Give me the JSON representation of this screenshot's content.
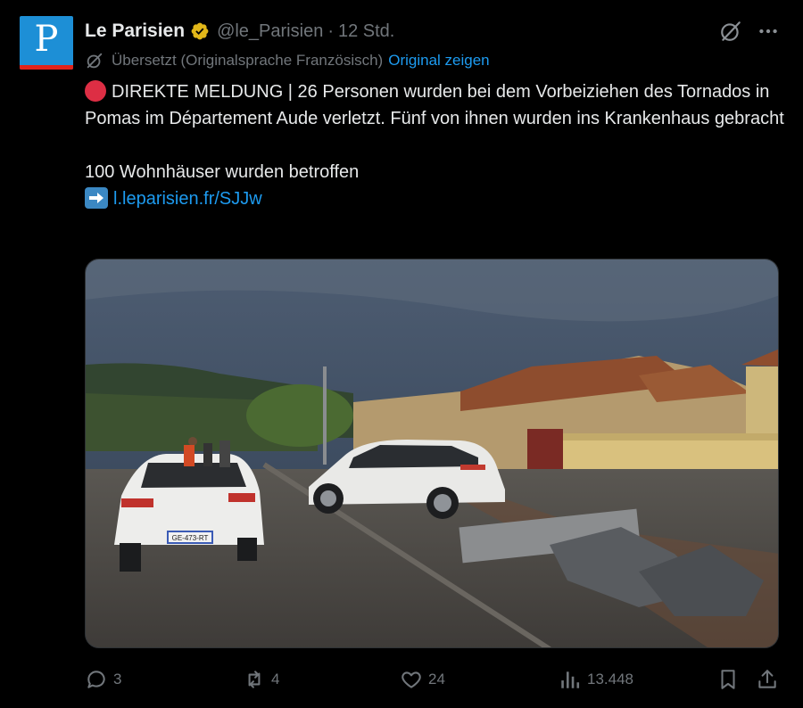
{
  "author": {
    "avatar_letter": "P",
    "name": "Le Parisien",
    "handle": "@le_Parisien",
    "separator": "·",
    "time": "12 Std.",
    "verified_color": "#e2b719"
  },
  "translation": {
    "note": "Übersetzt (Originalsprache Französisch)",
    "show_original": "Original zeigen"
  },
  "tweet": {
    "line1": "DIREKTE MELDUNG | 26 Personen wurden bei dem Vorbeiziehen des Tornados in Pomas im Département Aude verletzt. Fünf von ihnen wurden ins Krankenhaus gebracht",
    "line2": "100 Wohnhäuser wurden betroffen",
    "link": "l.leparisien.fr/SJJw",
    "plate": "GE-473-RT"
  },
  "metrics": {
    "replies": "3",
    "reposts": "4",
    "likes": "24",
    "views": "13.448"
  },
  "colors": {
    "background": "#000000",
    "text": "#e7e9ea",
    "muted": "#71767b",
    "link": "#1d9bf0"
  }
}
